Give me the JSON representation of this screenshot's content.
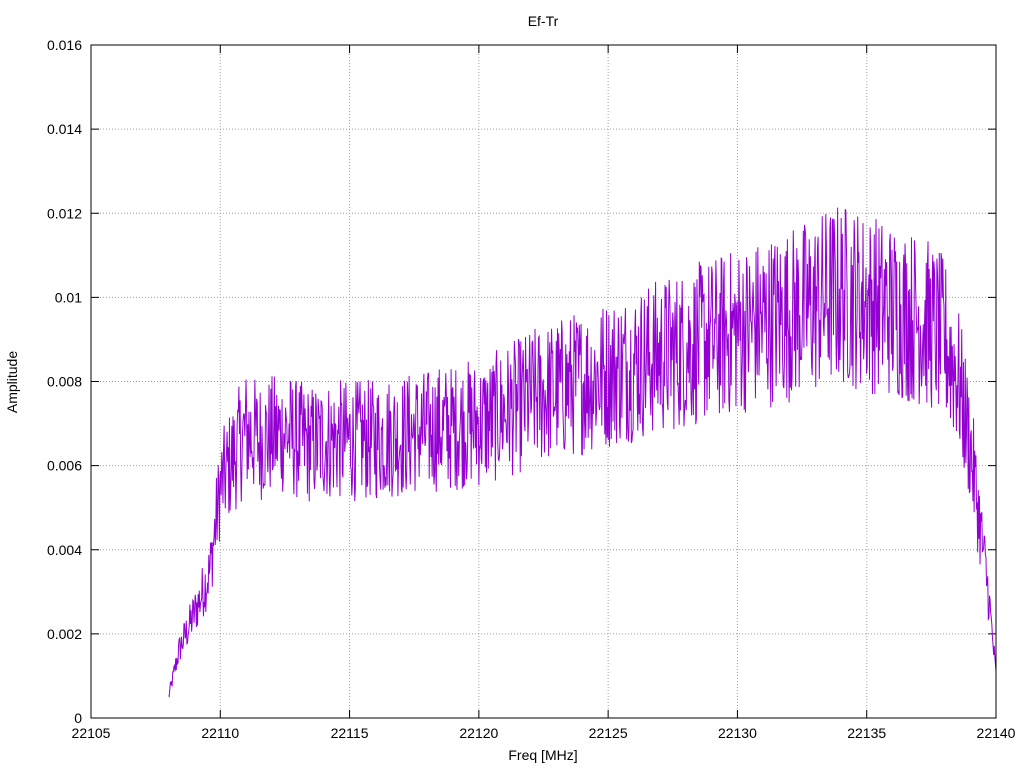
{
  "chart_data": {
    "type": "line",
    "title": "Ef-Tr",
    "xlabel": "Freq [MHz]",
    "ylabel": "Amplitude",
    "xlim": [
      22105,
      22140
    ],
    "ylim": [
      0,
      0.016
    ],
    "grid": true,
    "xticks": [
      22105,
      22110,
      22115,
      22120,
      22125,
      22130,
      22135,
      22140
    ],
    "xtick_labels": [
      "22105",
      "22110",
      "22115",
      "22120",
      "22125",
      "22130",
      "22135",
      "22140"
    ],
    "yticks": [
      0,
      0.002,
      0.004,
      0.006,
      0.008,
      0.01,
      0.012,
      0.014,
      0.016
    ],
    "ytick_labels": [
      "0",
      "0.002",
      "0.004",
      "0.006",
      "0.008",
      "0.01",
      "0.012",
      "0.014",
      "0.016"
    ],
    "series": [
      {
        "color": "#9400d3",
        "x": [
          22108.0,
          22108.4,
          22108.8,
          22109.2,
          22109.6,
          22110.0,
          22110.5,
          22111.0,
          22111.5,
          22112.0,
          22112.5,
          22113.0,
          22113.5,
          22114.0,
          22114.5,
          22115.0,
          22115.5,
          22116.0,
          22116.5,
          22117.0,
          22117.5,
          22118.0,
          22118.5,
          22119.0,
          22119.5,
          22120.0,
          22120.5,
          22121.0,
          22121.5,
          22122.0,
          22122.5,
          22123.0,
          22123.5,
          22124.0,
          22124.5,
          22125.0,
          22125.5,
          22126.0,
          22126.5,
          22127.0,
          22127.5,
          22128.0,
          22128.5,
          22129.0,
          22129.5,
          22130.0,
          22130.5,
          22131.0,
          22131.5,
          22132.0,
          22132.5,
          22133.0,
          22133.5,
          22134.0,
          22134.5,
          22135.0,
          22135.5,
          22136.0,
          22136.5,
          22137.0,
          22137.5,
          22138.0,
          22138.5,
          22139.0,
          22139.4,
          22139.7,
          22140.0
        ],
        "y": [
          0.0005,
          0.0016,
          0.0022,
          0.0028,
          0.0035,
          0.0055,
          0.0062,
          0.0068,
          0.0066,
          0.0067,
          0.0068,
          0.0066,
          0.0065,
          0.0066,
          0.0066,
          0.0066,
          0.0066,
          0.0066,
          0.0067,
          0.0067,
          0.0068,
          0.0068,
          0.0069,
          0.0069,
          0.007,
          0.007,
          0.0071,
          0.0073,
          0.0074,
          0.0076,
          0.0077,
          0.0078,
          0.0079,
          0.008,
          0.0081,
          0.0082,
          0.0083,
          0.0084,
          0.0085,
          0.0086,
          0.0087,
          0.0088,
          0.0089,
          0.009,
          0.0091,
          0.0092,
          0.0093,
          0.0094,
          0.0095,
          0.0096,
          0.0097,
          0.0098,
          0.01,
          0.0101,
          0.01,
          0.0099,
          0.0098,
          0.0097,
          0.0096,
          0.0095,
          0.0093,
          0.009,
          0.0082,
          0.0065,
          0.0045,
          0.003,
          0.001
        ]
      }
    ]
  }
}
